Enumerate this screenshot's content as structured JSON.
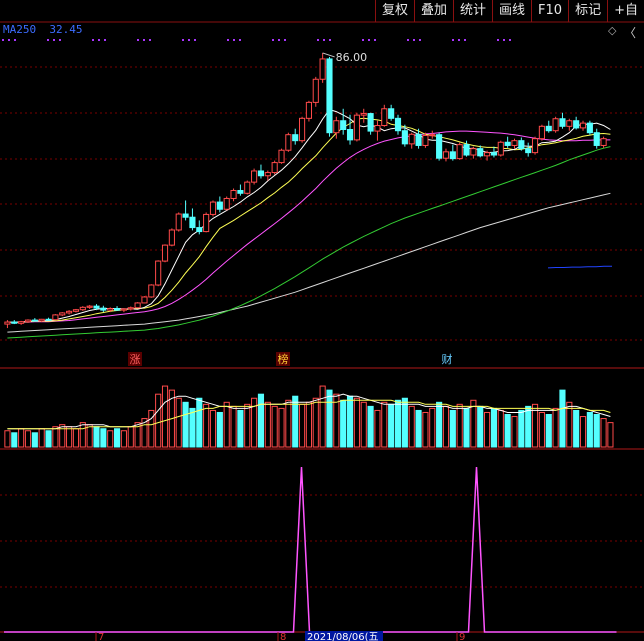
{
  "toolbar": {
    "buttons": [
      "复权",
      "叠加",
      "统计",
      "画线",
      "F10",
      "标记",
      "+自"
    ]
  },
  "legend": {
    "ma_label": "MA250",
    "ma_value": "32.45"
  },
  "colors": {
    "up": "#ff4a4a",
    "down": "#54ffff",
    "grid": "#7a0000",
    "ma5": "#ffffff",
    "ma10": "#ffff55",
    "ma20": "#ff55ff",
    "ma60": "#33cc33",
    "ma250": "#d8d8d8",
    "ma_extra": "#2244ff",
    "indicator": "#ff55ff",
    "marker_dot": "#aa33ff"
  },
  "chart_data": [
    {
      "type": "candlestick",
      "annotations": {
        "peak_label": "86.00",
        "peak_value": 86.0
      },
      "event_markers": [
        "涨",
        "榜",
        "财"
      ],
      "candles": [
        [
          18,
          19,
          17,
          18.5
        ],
        [
          18.5,
          19,
          18,
          18.2
        ],
        [
          18.2,
          18.8,
          17.8,
          18.6
        ],
        [
          18.6,
          19.2,
          18.3,
          19
        ],
        [
          19,
          19.5,
          18.7,
          18.8
        ],
        [
          18.8,
          19.3,
          18.5,
          19.2
        ],
        [
          19.2,
          19.6,
          18.9,
          19.1
        ],
        [
          19.1,
          20.5,
          19,
          20.3
        ],
        [
          20.3,
          21,
          20,
          20.8
        ],
        [
          20.8,
          21.5,
          20.4,
          21.2
        ],
        [
          21.2,
          21.8,
          20.9,
          21.6
        ],
        [
          21.6,
          22.5,
          21.3,
          22.2
        ],
        [
          22.2,
          22.8,
          21.8,
          22.5
        ],
        [
          22.5,
          23,
          21.5,
          22
        ],
        [
          22,
          22.6,
          21,
          21.5
        ],
        [
          21.5,
          22.2,
          21,
          21.9
        ],
        [
          21.9,
          22.5,
          21.3,
          21.5
        ],
        [
          21.5,
          22,
          21,
          21.8
        ],
        [
          21.8,
          22.4,
          21.4,
          22.1
        ],
        [
          22.1,
          23.5,
          22,
          23.3
        ],
        [
          23.3,
          25,
          23.2,
          24.8
        ],
        [
          24.8,
          28,
          24.6,
          27.8
        ],
        [
          27.8,
          34,
          27.5,
          33.8
        ],
        [
          33.8,
          38,
          33.5,
          37.8
        ],
        [
          37.8,
          42,
          37.5,
          41.6
        ],
        [
          41.6,
          46,
          41.2,
          45.6
        ],
        [
          45.6,
          49,
          44,
          44.8
        ],
        [
          44.8,
          47,
          41.5,
          42.2
        ],
        [
          42.2,
          44,
          40.5,
          41.2
        ],
        [
          41.2,
          46,
          41,
          45.5
        ],
        [
          45.5,
          49,
          45,
          48.6
        ],
        [
          48.6,
          50,
          46,
          46.8
        ],
        [
          46.8,
          50,
          46.5,
          49.5
        ],
        [
          49.5,
          52,
          48.8,
          51.5
        ],
        [
          51.5,
          53,
          50.2,
          50.8
        ],
        [
          50.8,
          54,
          50.5,
          53.6
        ],
        [
          53.6,
          57,
          53,
          56.4
        ],
        [
          56.4,
          58,
          54.5,
          55.2
        ],
        [
          55.2,
          56.5,
          54,
          56
        ],
        [
          56,
          59,
          55.5,
          58.5
        ],
        [
          58.5,
          62,
          58.2,
          61.6
        ],
        [
          61.6,
          66,
          61.2,
          65.5
        ],
        [
          65.5,
          67,
          63,
          64
        ],
        [
          64,
          70,
          63.5,
          69.6
        ],
        [
          69.6,
          74,
          68.8,
          73.6
        ],
        [
          73.6,
          80,
          72.5,
          79.4
        ],
        [
          79.4,
          86,
          78.5,
          84.5
        ],
        [
          84.5,
          85,
          65,
          66
        ],
        [
          66,
          70,
          64.5,
          69
        ],
        [
          69,
          72,
          65.5,
          66.8
        ],
        [
          66.8,
          70.5,
          63,
          64.2
        ],
        [
          64.2,
          71,
          63.8,
          70.4
        ],
        [
          70.4,
          72,
          68.5,
          70.8
        ],
        [
          70.8,
          71,
          65.5,
          66.4
        ],
        [
          66.4,
          69,
          64,
          67.8
        ],
        [
          67.8,
          73,
          67.5,
          72
        ],
        [
          72,
          73,
          69,
          69.6
        ],
        [
          69.6,
          70.5,
          65.5,
          66.5
        ],
        [
          66.5,
          68,
          62.5,
          63.2
        ],
        [
          63.2,
          66,
          62,
          65.6
        ],
        [
          65.6,
          67,
          62,
          62.8
        ],
        [
          62.8,
          66,
          62.2,
          65.3
        ],
        [
          65.3,
          66.5,
          64.5,
          65.5
        ],
        [
          65.5,
          66,
          59,
          59.6
        ],
        [
          59.6,
          62,
          58.8,
          61.2
        ],
        [
          61.2,
          63,
          59,
          59.5
        ],
        [
          59.5,
          63.5,
          59.2,
          63
        ],
        [
          63,
          64,
          60,
          60.4
        ],
        [
          60.4,
          62.5,
          59.5,
          62
        ],
        [
          62,
          62.8,
          59.8,
          60.2
        ],
        [
          60.2,
          61.5,
          59,
          61
        ],
        [
          61,
          62.5,
          59.8,
          60.4
        ],
        [
          60.4,
          64,
          60,
          63.6
        ],
        [
          63.6,
          65,
          62.2,
          62.8
        ],
        [
          62.8,
          64.5,
          62,
          64
        ],
        [
          64,
          64.8,
          61.5,
          62
        ],
        [
          62,
          63.5,
          60,
          61
        ],
        [
          61,
          65,
          60.5,
          64.5
        ],
        [
          64.5,
          68,
          64,
          67.6
        ],
        [
          67.6,
          69,
          66,
          66.5
        ],
        [
          66.5,
          70,
          66,
          69.5
        ],
        [
          69.5,
          71,
          67,
          67.6
        ],
        [
          67.6,
          69.5,
          66.5,
          69
        ],
        [
          69,
          70,
          66.8,
          67.2
        ],
        [
          67.2,
          69,
          66.5,
          68.4
        ],
        [
          68.4,
          69,
          65.5,
          66
        ],
        [
          66,
          67,
          62,
          62.8
        ],
        [
          62.8,
          65,
          62.2,
          64.5
        ]
      ],
      "ma5": [
        18.5,
        18.5,
        18.5,
        18.7,
        18.8,
        18.8,
        18.9,
        19.1,
        19.5,
        19.9,
        20.4,
        20.9,
        21.4,
        21.7,
        21.9,
        21.9,
        21.9,
        21.8,
        21.8,
        21.7,
        22.2,
        23.1,
        25.1,
        28.1,
        31.6,
        35,
        38.5,
        40.4,
        41.6,
        43.1,
        44.5,
        45.5,
        46.5,
        47.5,
        48.6,
        49.9,
        51,
        52.3,
        53.9,
        55.3,
        56.6,
        58.2,
        60,
        62.2,
        64.5,
        66.6,
        69.4,
        71.8,
        71.3,
        70.4,
        69.5,
        67.9,
        67.5,
        67.9,
        67.4,
        66.5,
        67,
        67.2,
        67.2,
        66.4,
        65.6,
        64.4,
        64.1,
        64.1,
        63.7,
        63.3,
        62.7,
        62,
        62.1,
        61.6,
        61,
        61.1,
        61.4,
        61.5,
        61.8,
        62.7,
        62.6,
        62.6,
        63.5,
        63.6,
        63.9,
        64.9,
        66,
        67.7,
        68.1,
        68.1,
        68.4,
        67.8,
        66.8
      ],
      "ma10": [
        18.5,
        18.5,
        18.5,
        18.6,
        18.7,
        18.7,
        18.7,
        18.8,
        19,
        19.3,
        19.6,
        19.9,
        20.2,
        20.6,
        20.9,
        21.2,
        21.4,
        21.6,
        21.8,
        21.9,
        22,
        22.4,
        23.2,
        24.7,
        26.5,
        28.5,
        30.8,
        32.8,
        34.9,
        37.4,
        39.8,
        42,
        43,
        44,
        45.1,
        46.2,
        47.3,
        48.4,
        49.7,
        50.9,
        52.3,
        53.6,
        55.2,
        57,
        58.6,
        60.2,
        62.2,
        64.1,
        65.9,
        67.3,
        68.3,
        69.4,
        69.6,
        69.4,
        69.2,
        68.9,
        68.1,
        67.8,
        67.5,
        67.1,
        66.4,
        65.6,
        65.3,
        65,
        64.6,
        64.2,
        63.7,
        63.2,
        62.8,
        62.5,
        62.3,
        62.3,
        62.1,
        62,
        61.7,
        61.8,
        62.2,
        62.5,
        63,
        63.2,
        63.5,
        63.9,
        64.2,
        64.6,
        65.1,
        65.4,
        65.7,
        65.8,
        65.6
      ],
      "ma20": [
        18.5,
        18.5,
        18.5,
        18.5,
        18.6,
        18.6,
        18.6,
        18.7,
        18.8,
        18.9,
        19.1,
        19.3,
        19.5,
        19.7,
        19.9,
        20.1,
        20.3,
        20.5,
        20.7,
        20.9,
        21.1,
        21.4,
        21.8,
        22.4,
        23.2,
        24.2,
        25.3,
        26.5,
        27.8,
        29.2,
        30.8,
        32.3,
        33.8,
        35.2,
        36.6,
        38,
        39.3,
        40.6,
        41.9,
        43.2,
        44.5,
        45.9,
        47.3,
        48.8,
        50.4,
        52,
        53.8,
        55.5,
        57.1,
        58.5,
        59.8,
        60.9,
        61.8,
        62.6,
        63.3,
        63.9,
        64.3,
        64.7,
        65,
        65.2,
        65.5,
        65.7,
        65.8,
        66,
        66.2,
        66.3,
        66.4,
        66.4,
        66.3,
        66.2,
        66.1,
        66,
        65.9,
        65.7,
        65.5,
        65.2,
        64.9,
        64.6,
        64.4,
        64.2,
        64.1,
        64,
        64,
        64,
        64.1,
        64.1,
        64.2,
        64.2,
        64.2
      ],
      "ma60": [
        14.5,
        14.6,
        14.7,
        14.8,
        14.9,
        15,
        15.1,
        15.2,
        15.3,
        15.4,
        15.5,
        15.6,
        15.7,
        15.8,
        15.9,
        16,
        16.1,
        16.2,
        16.3,
        16.4,
        16.5,
        16.7,
        16.9,
        17.2,
        17.5,
        17.8,
        18.2,
        18.6,
        19,
        19.5,
        20,
        20.6,
        21.2,
        21.9,
        22.6,
        23.4,
        24.2,
        25.1,
        26,
        26.9,
        27.9,
        28.9,
        29.9,
        31,
        32.1,
        33.2,
        34.3,
        35.3,
        36.3,
        37.3,
        38.2,
        39.1,
        40,
        40.8,
        41.6,
        42.4,
        43.2,
        43.9,
        44.6,
        45.2,
        45.8,
        46.4,
        47,
        47.6,
        48.2,
        48.8,
        49.4,
        50,
        50.6,
        51.2,
        51.8,
        52.4,
        53,
        53.6,
        54.2,
        54.8,
        55.4,
        56,
        56.6,
        57.2,
        57.8,
        58.5,
        59.2,
        59.8,
        60.4,
        61,
        61.6,
        62.1,
        62.5
      ],
      "ma250": [
        16,
        16.1,
        16.2,
        16.3,
        16.4,
        16.5,
        16.6,
        16.7,
        16.8,
        16.9,
        17,
        17.1,
        17.2,
        17.3,
        17.4,
        17.5,
        17.6,
        17.7,
        17.8,
        17.9,
        18,
        18.2,
        18.4,
        18.6,
        18.8,
        19,
        19.3,
        19.6,
        19.9,
        20.2,
        20.5,
        20.9,
        21.3,
        21.7,
        22.1,
        22.5,
        23,
        23.5,
        24,
        24.5,
        25,
        25.5,
        26,
        26.6,
        27.2,
        27.8,
        28.4,
        29,
        29.6,
        30.2,
        30.8,
        31.4,
        32,
        32.6,
        33.2,
        33.8,
        34.4,
        35,
        35.6,
        36.2,
        36.8,
        37.4,
        38,
        38.6,
        39.2,
        39.8,
        40.4,
        41,
        41.6,
        42.2,
        42.7,
        43.2,
        43.7,
        44.2,
        44.7,
        45.2,
        45.7,
        46.2,
        46.7,
        47.2,
        47.6,
        48,
        48.4,
        48.8,
        49.2,
        49.6,
        50,
        50.4,
        50.8
      ],
      "ma_extra": [
        32.1,
        32.2,
        32.2,
        32.3,
        32.3,
        32.4,
        32.4,
        32.5,
        32.5
      ]
    },
    {
      "type": "bar",
      "name": "volume",
      "values": [
        8,
        7,
        9,
        8,
        7,
        9,
        8,
        10,
        11,
        10,
        9,
        12,
        11,
        10,
        9,
        8,
        9,
        8,
        10,
        12,
        14,
        18,
        26,
        30,
        28,
        24,
        22,
        19,
        24,
        21,
        18,
        17,
        22,
        20,
        18,
        21,
        24,
        26,
        22,
        20,
        19,
        23,
        25,
        21,
        22,
        24,
        30,
        28,
        26,
        23,
        25,
        24,
        22,
        20,
        18,
        22,
        21,
        23,
        24,
        20,
        18,
        17,
        19,
        22,
        20,
        18,
        21,
        19,
        23,
        20,
        17,
        19,
        18,
        16,
        15,
        18,
        20,
        21,
        17,
        16,
        19,
        28,
        22,
        18,
        15,
        17,
        16,
        14,
        12
      ],
      "ma_short": [
        9,
        9,
        9,
        9,
        9,
        9,
        9,
        9,
        10,
        10,
        10,
        11,
        11,
        11,
        11,
        10,
        10,
        10,
        10,
        11,
        12,
        14,
        18,
        22,
        24,
        25,
        25,
        24,
        23,
        22,
        21,
        20,
        20,
        19,
        19,
        19,
        20,
        21,
        21,
        21,
        21,
        22,
        22,
        22,
        22,
        23,
        24,
        25,
        25,
        26,
        25,
        25,
        24,
        23,
        22,
        21,
        21,
        21,
        21,
        21,
        21,
        20,
        20,
        20,
        20,
        19,
        19,
        19,
        20,
        20,
        19,
        19,
        18,
        17,
        17,
        17,
        18,
        18,
        18,
        18,
        18,
        19,
        20,
        20,
        19,
        18,
        17,
        16,
        15
      ],
      "ma_long": [
        9,
        9,
        9,
        9,
        9,
        9,
        9,
        9,
        9,
        9,
        9,
        9,
        10,
        10,
        10,
        10,
        10,
        10,
        10,
        10,
        11,
        11,
        12,
        13,
        14,
        15,
        16,
        17,
        18,
        19,
        19,
        20,
        20,
        20,
        20,
        20,
        20,
        21,
        21,
        21,
        21,
        21,
        21,
        21,
        21,
        22,
        22,
        22,
        22,
        23,
        23,
        23,
        23,
        23,
        23,
        23,
        23,
        22,
        22,
        22,
        22,
        21,
        21,
        21,
        21,
        20,
        20,
        20,
        20,
        20,
        20,
        19,
        19,
        19,
        19,
        19,
        19,
        19,
        19,
        19,
        18,
        19,
        19,
        19,
        19,
        18,
        18,
        18,
        17
      ]
    },
    {
      "type": "line",
      "name": "indicator",
      "x": [
        0,
        1,
        2,
        3,
        4,
        5,
        6,
        7,
        8,
        9,
        10,
        11,
        12,
        13,
        14,
        15,
        16,
        17,
        18,
        19,
        20,
        21,
        22,
        23,
        24,
        25,
        26,
        27,
        28,
        29,
        30,
        31,
        32,
        33,
        34,
        35
      ],
      "values": [
        0,
        0,
        0,
        0,
        0,
        0,
        0,
        0,
        0,
        0,
        0,
        0,
        0,
        0,
        0,
        0,
        0,
        100,
        0,
        0,
        0,
        0,
        0,
        0,
        0,
        0,
        0,
        100,
        0,
        0,
        0,
        0,
        0,
        0,
        0,
        0
      ]
    }
  ],
  "x_axis": {
    "ticks": [
      "7",
      "8",
      "9"
    ],
    "highlighted_date": "2021/08/06(五"
  }
}
